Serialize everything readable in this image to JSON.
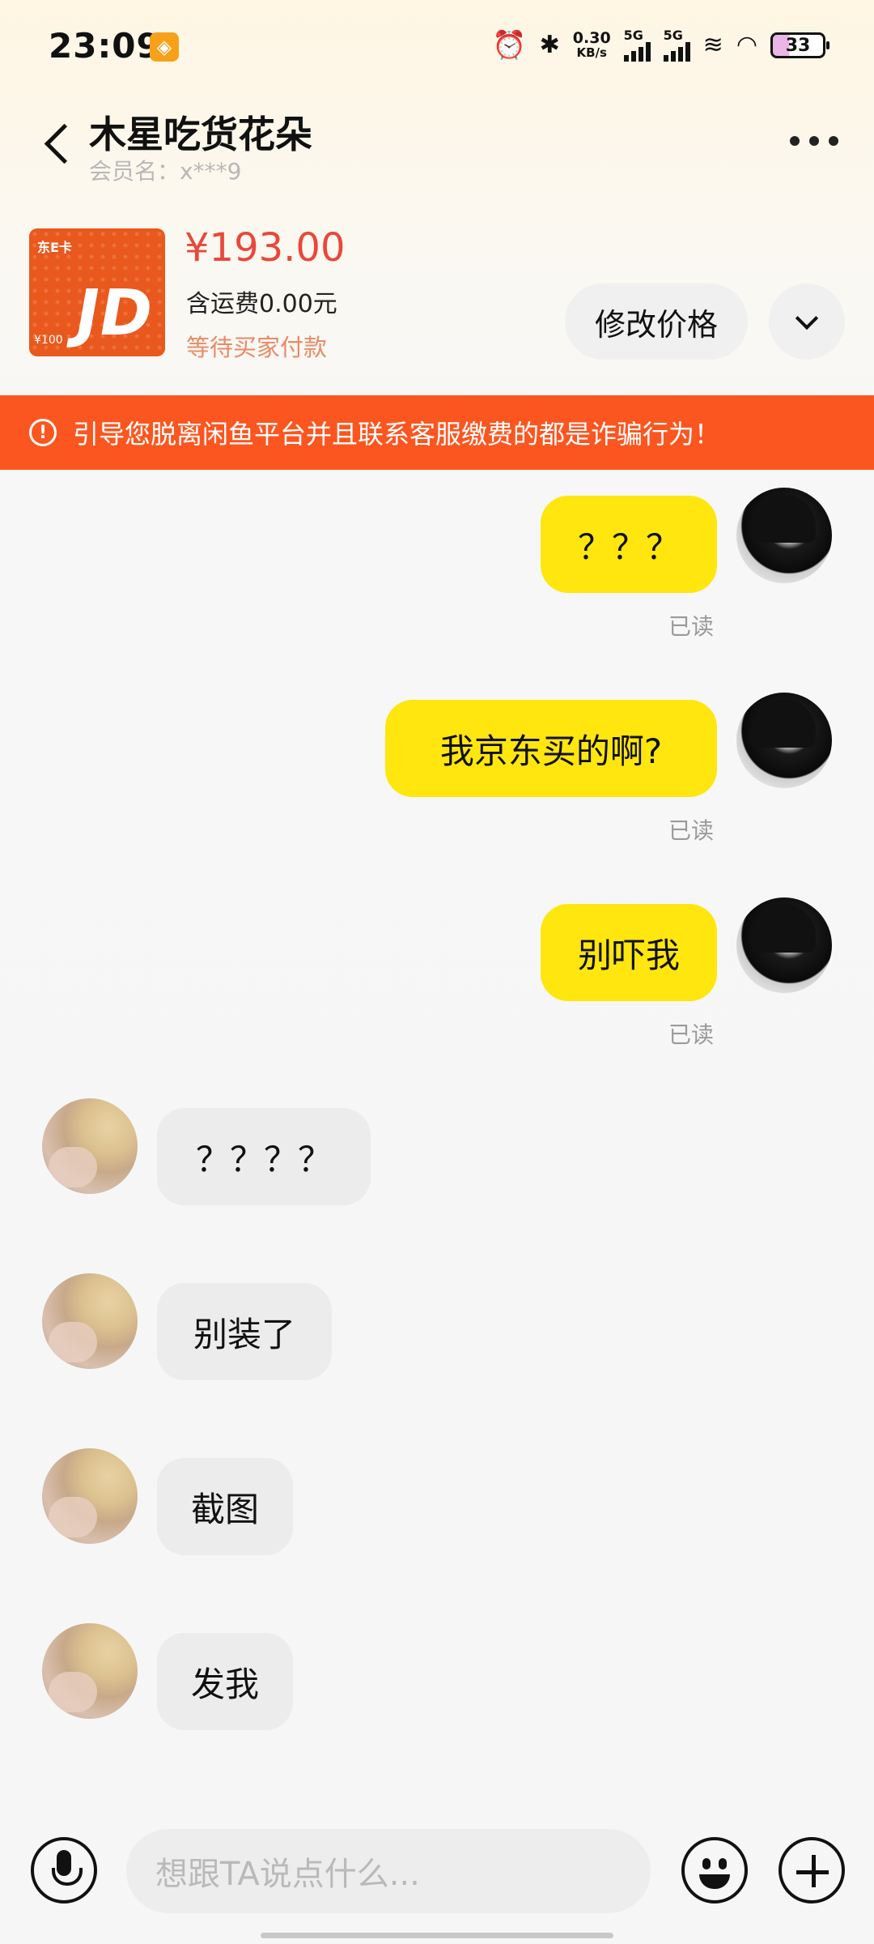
{
  "status_bar": {
    "time": "23:09",
    "app_badge": "◈",
    "net_speed_value": "0.30",
    "net_speed_unit": "KB/s",
    "sim1": "5G",
    "sim2": "5G",
    "battery": "33",
    "icons": [
      "alarm-icon",
      "bluetooth-icon",
      "signal-icon",
      "signal-icon",
      "hotspot-wifi-icon",
      "wifi-icon",
      "battery-icon"
    ]
  },
  "header": {
    "title": "木星吃货花朵",
    "subtitle": "会员名：x***9"
  },
  "product": {
    "card_brand": "东E卡",
    "card_logo": "JD",
    "card_value": "¥100",
    "price": "¥193.00",
    "shipping": "含运费0.00元",
    "status": "等待买家付款",
    "edit_price_label": "修改价格"
  },
  "warning": {
    "icon": "!",
    "text": "引导您脱离闲鱼平台并且联系客服缴费的都是诈骗行为！"
  },
  "messages": [
    {
      "from": "me",
      "text": "？？？",
      "read": "已读"
    },
    {
      "from": "me",
      "text": "我京东买的啊?",
      "read": "已读"
    },
    {
      "from": "me",
      "text": "别吓我",
      "read": "已读"
    },
    {
      "from": "them",
      "text": "？？？？"
    },
    {
      "from": "them",
      "text": "别装了"
    },
    {
      "from": "them",
      "text": "截图"
    },
    {
      "from": "them",
      "text": "发我"
    }
  ],
  "composer": {
    "placeholder": "想跟TA说点什么..."
  },
  "colors": {
    "my_bubble": "#ffe60f",
    "their_bubble": "#ececec",
    "warning_bg": "#fb5620",
    "price": "#e8483b"
  }
}
